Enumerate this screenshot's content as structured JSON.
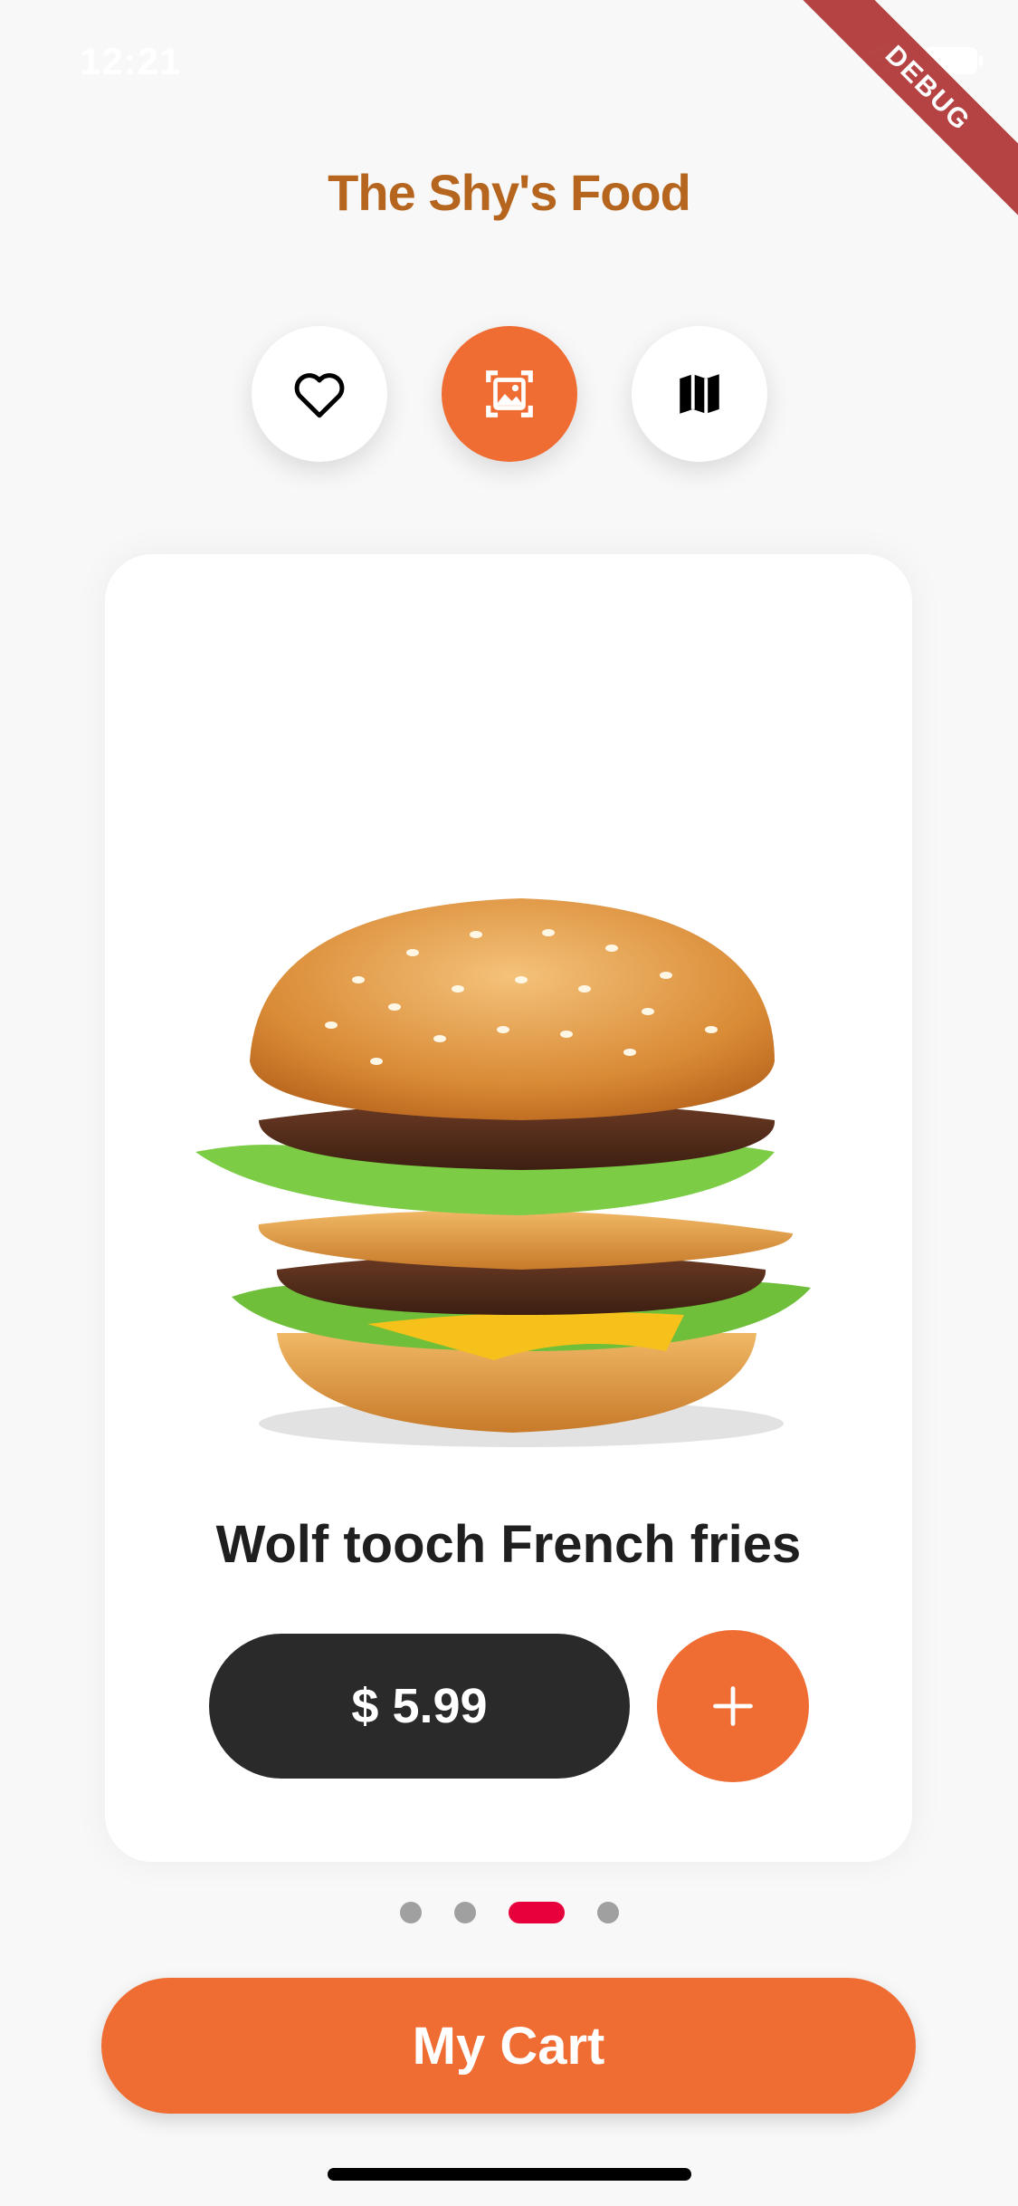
{
  "status_bar": {
    "time": "12:21",
    "debug_label": "DEBUG"
  },
  "header": {
    "title": "The Shy's Food"
  },
  "top_actions": [
    {
      "icon": "heart-icon",
      "active": false
    },
    {
      "icon": "gallery-icon",
      "active": true
    },
    {
      "icon": "map-icon",
      "active": false
    }
  ],
  "product": {
    "image": "burger-image",
    "name": "Wolf tooch French fries",
    "price": "$ 5.99",
    "add_icon": "plus-icon"
  },
  "pagination": {
    "count": 4,
    "active_index": 2
  },
  "cart_button": {
    "label": "My Cart"
  },
  "colors": {
    "accent": "#ef6c33",
    "title": "#b5651d",
    "active_dot": "#e8003d",
    "dark": "#2a2a2a"
  }
}
